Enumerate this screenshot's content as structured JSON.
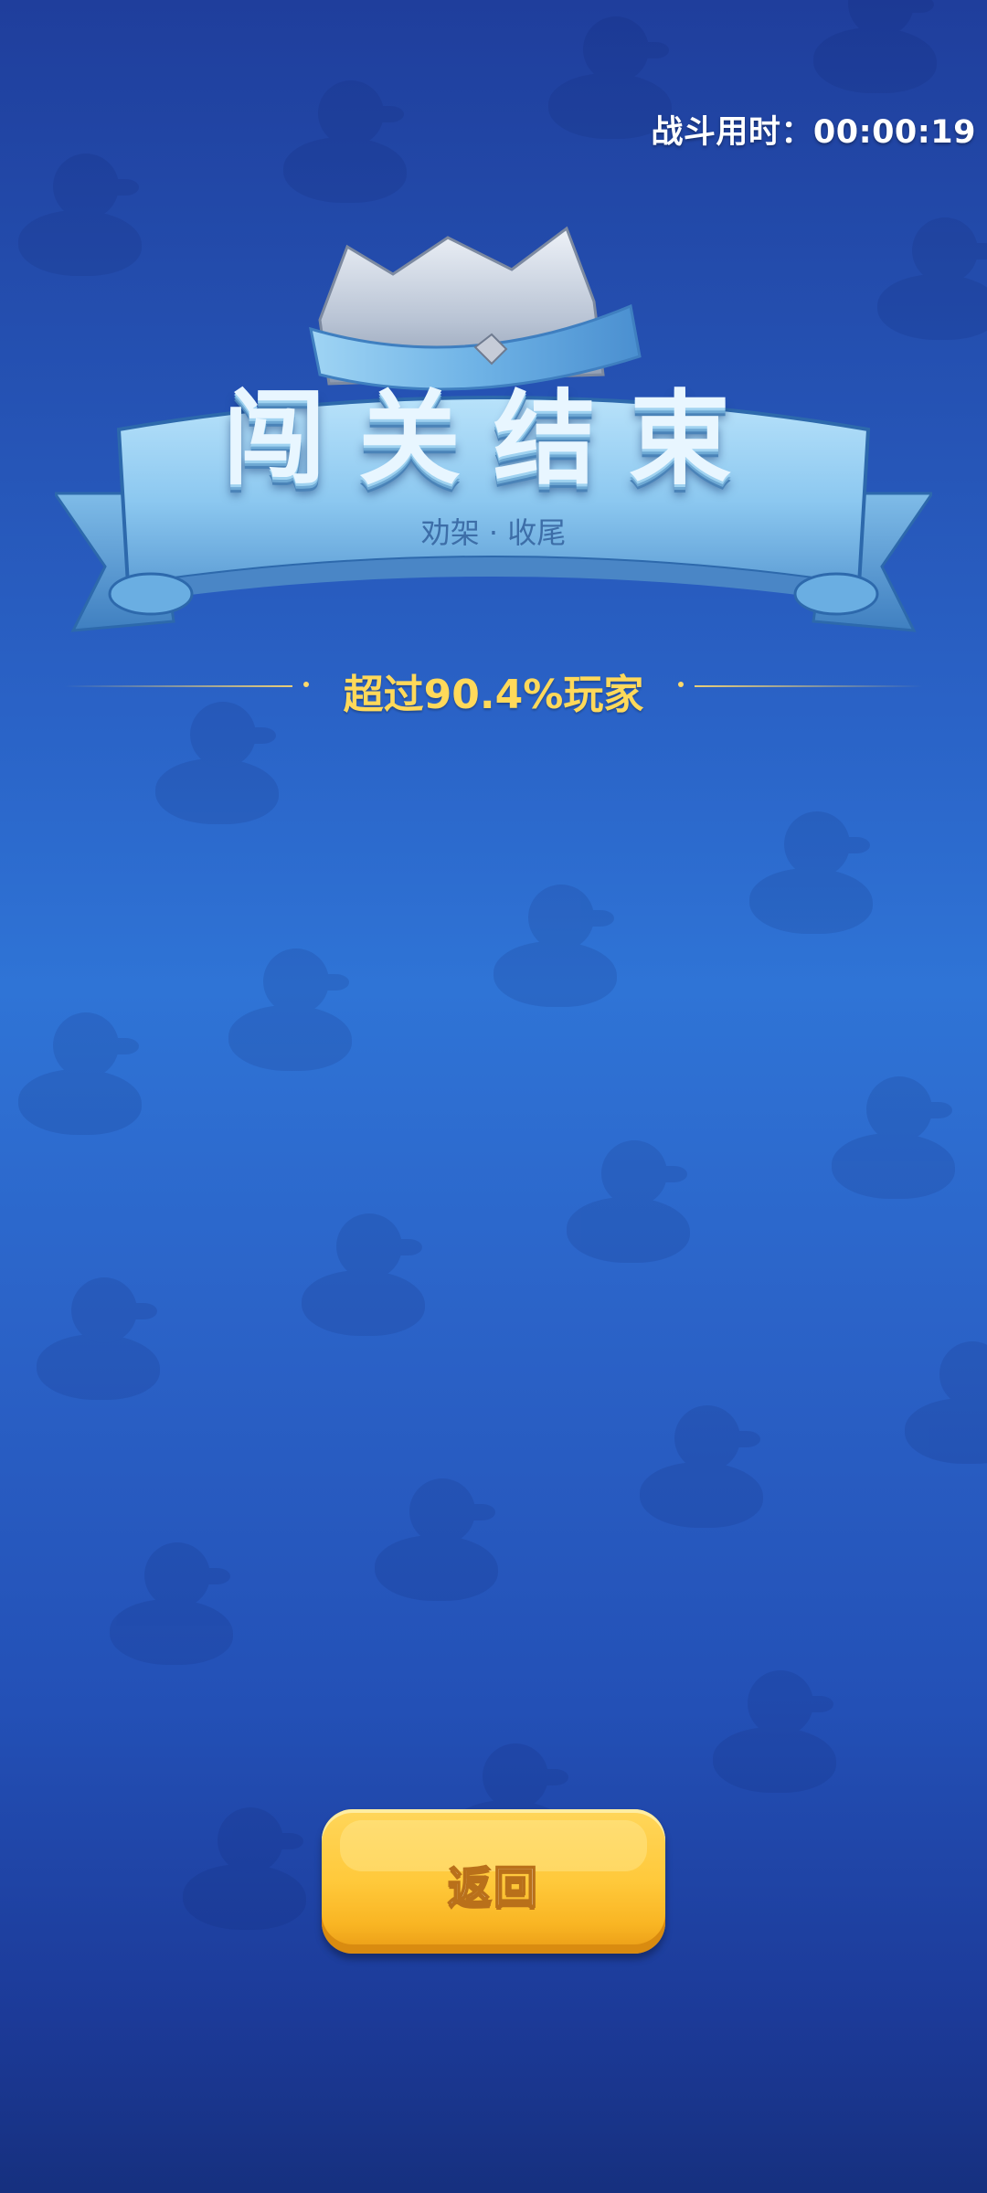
{
  "header": {
    "timer_label": "战斗用时：",
    "timer_value": "00:00:19"
  },
  "result": {
    "title": "闯关结束",
    "subtitle": "劝架 · 收尾",
    "rank_text": "超过90.4%玩家"
  },
  "actions": {
    "back_label": "返回"
  },
  "colors": {
    "background_top": "#1f3e9c",
    "background_mid": "#2f74d6",
    "background_bottom": "#16307f",
    "ribbon": "#8cc8f0",
    "rank_text": "#ffd95a",
    "button": "#ffc93b"
  },
  "icons": {
    "crown": "crown-icon",
    "background_pattern": "duck-icon"
  }
}
